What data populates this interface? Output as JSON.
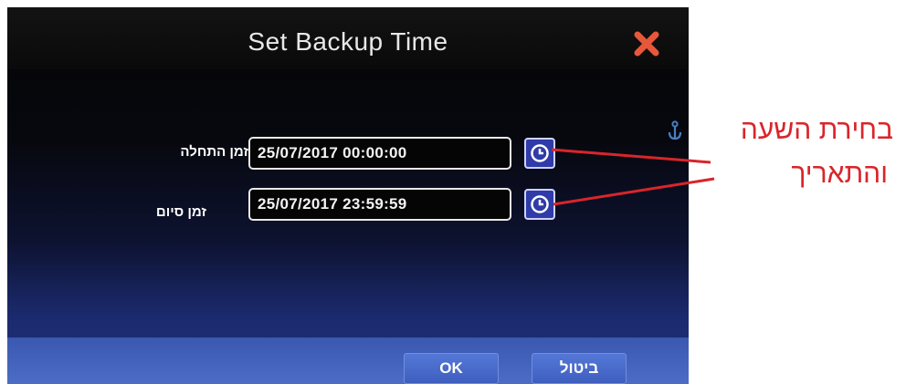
{
  "dialog": {
    "title": "Set Backup Time",
    "close_icon": "close-x-icon",
    "start_label": "זמן התחלה",
    "start_value": "25/07/2017 00:00:00",
    "end_label": "זמן סיום",
    "end_value": "25/07/2017 23:59:59",
    "clock_icon": "clock-icon",
    "ok_label": "OK",
    "cancel_label": "ביטול"
  },
  "annotation": {
    "line1": "בחירת השעה",
    "line2": "והתאריך",
    "anchor_icon": "anchor-icon"
  },
  "colors": {
    "accent_blue": "#3f5fbf",
    "close_red": "#e8573a",
    "annotation_red": "#d9252b"
  }
}
